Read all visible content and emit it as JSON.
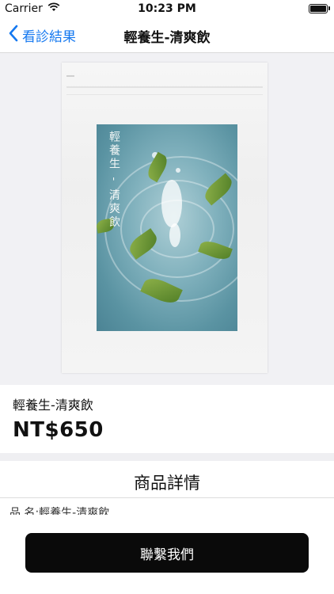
{
  "status_bar": {
    "carrier": "Carrier",
    "time": "10:23 PM"
  },
  "nav": {
    "back_label": "看診結果",
    "title": "輕養生-清爽飲"
  },
  "product": {
    "image_label_text": "輕養生 - 清爽飲",
    "name": "輕養生-清爽飲",
    "price": "NT$650"
  },
  "details": {
    "title": "商品詳情",
    "first_line": "品 名:輕養生-清爽飲"
  },
  "actions": {
    "contact_label": "聯繫我們"
  },
  "colors": {
    "accent": "#1478f0",
    "button_bg": "#0a0a0a",
    "page_bg": "#ffffff",
    "image_bg": "#f1f1f4"
  },
  "icons": [
    "wifi-icon",
    "battery-icon",
    "chevron-left-icon"
  ]
}
